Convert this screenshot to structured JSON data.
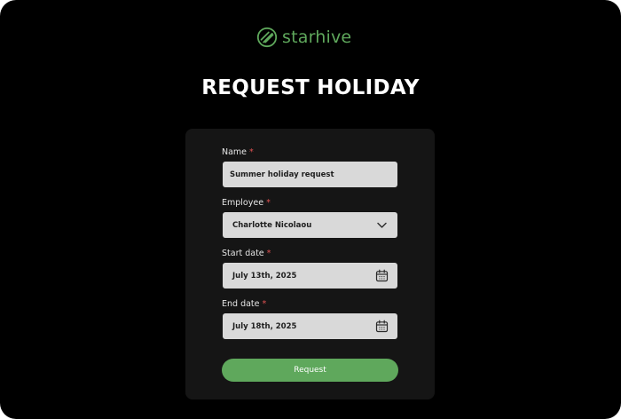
{
  "brand": {
    "name": "starhive",
    "color": "#5fa85c",
    "icon": "starhive-logo-icon"
  },
  "page": {
    "title": "REQUEST HOLIDAY"
  },
  "form": {
    "name": {
      "label": "Name",
      "required_mark": "*",
      "value": "Summer holiday request"
    },
    "employee": {
      "label": "Employee",
      "required_mark": "*",
      "value": "Charlotte Nicolaou",
      "icon": "chevron-down-icon"
    },
    "start_date": {
      "label": "Start date",
      "required_mark": "*",
      "value": "July 13th, 2025",
      "icon": "calendar-icon"
    },
    "end_date": {
      "label": "End date",
      "required_mark": "*",
      "value": "July 18th, 2025",
      "icon": "calendar-icon"
    },
    "submit": {
      "label": "Request"
    }
  },
  "colors": {
    "background": "#000000",
    "card": "#151515",
    "field": "#d9d9d9",
    "accent": "#5fa85c",
    "required": "#e05252"
  }
}
